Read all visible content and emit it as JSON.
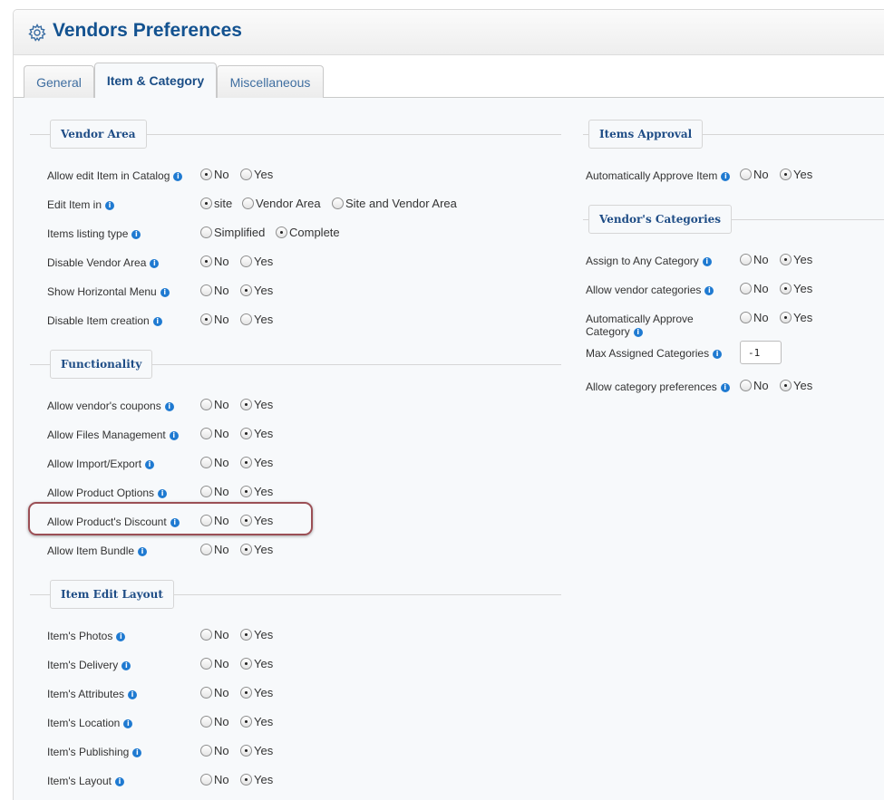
{
  "page": {
    "title": "Vendors Preferences",
    "icon": "gear-icon"
  },
  "tabs": [
    {
      "label": "General"
    },
    {
      "label": "Item & Category"
    },
    {
      "label": "Miscellaneous"
    }
  ],
  "left": {
    "vendor_area": {
      "legend": "Vendor Area",
      "rows": [
        {
          "label": "Allow edit Item in Catalog",
          "options": [
            "No",
            "Yes"
          ],
          "selected": "No"
        },
        {
          "label": "Edit Item in",
          "options": [
            "site",
            "Vendor Area",
            "Site and Vendor Area"
          ],
          "selected": "site"
        },
        {
          "label": "Items listing type",
          "options": [
            "Simplified",
            "Complete"
          ],
          "selected": "Complete"
        },
        {
          "label": "Disable Vendor Area",
          "options": [
            "No",
            "Yes"
          ],
          "selected": "No"
        },
        {
          "label": "Show Horizontal Menu",
          "options": [
            "No",
            "Yes"
          ],
          "selected": "Yes"
        },
        {
          "label": "Disable Item creation",
          "options": [
            "No",
            "Yes"
          ],
          "selected": "No"
        }
      ]
    },
    "functionality": {
      "legend": "Functionality",
      "rows": [
        {
          "label": "Allow vendor's coupons",
          "options": [
            "No",
            "Yes"
          ],
          "selected": "Yes"
        },
        {
          "label": "Allow Files Management",
          "options": [
            "No",
            "Yes"
          ],
          "selected": "Yes"
        },
        {
          "label": "Allow Import/Export",
          "options": [
            "No",
            "Yes"
          ],
          "selected": "Yes"
        },
        {
          "label": "Allow Product Options",
          "options": [
            "No",
            "Yes"
          ],
          "selected": "Yes"
        },
        {
          "label": "Allow Product's Discount",
          "options": [
            "No",
            "Yes"
          ],
          "selected": "Yes"
        },
        {
          "label": "Allow Item Bundle",
          "options": [
            "No",
            "Yes"
          ],
          "selected": "Yes"
        }
      ]
    },
    "item_edit_layout": {
      "legend": "Item Edit Layout",
      "rows": [
        {
          "label": "Item's Photos",
          "options": [
            "No",
            "Yes"
          ],
          "selected": "Yes"
        },
        {
          "label": "Item's Delivery",
          "options": [
            "No",
            "Yes"
          ],
          "selected": "Yes"
        },
        {
          "label": "Item's Attributes",
          "options": [
            "No",
            "Yes"
          ],
          "selected": "Yes"
        },
        {
          "label": "Item's Location",
          "options": [
            "No",
            "Yes"
          ],
          "selected": "Yes"
        },
        {
          "label": "Item's Publishing",
          "options": [
            "No",
            "Yes"
          ],
          "selected": "Yes"
        },
        {
          "label": "Item's Layout",
          "options": [
            "No",
            "Yes"
          ],
          "selected": "Yes"
        }
      ]
    }
  },
  "right": {
    "items_approval": {
      "legend": "Items Approval",
      "rows": [
        {
          "label": "Automatically Approve Item",
          "options": [
            "No",
            "Yes"
          ],
          "selected": "Yes"
        }
      ]
    },
    "vendor_categories": {
      "legend": "Vendor's Categories",
      "rows": [
        {
          "label": "Assign to Any Category",
          "options": [
            "No",
            "Yes"
          ],
          "selected": "Yes"
        },
        {
          "label": "Allow vendor categories",
          "options": [
            "No",
            "Yes"
          ],
          "selected": "Yes"
        },
        {
          "label": "Automatically Approve",
          "label2": "Category",
          "options": [
            "No",
            "Yes"
          ],
          "selected": "Yes"
        },
        {
          "label": "Max Assigned Categories",
          "value": "-1"
        },
        {
          "label": "Allow category preferences",
          "options": [
            "No",
            "Yes"
          ],
          "selected": "Yes"
        }
      ]
    }
  },
  "info_glyph": "i"
}
